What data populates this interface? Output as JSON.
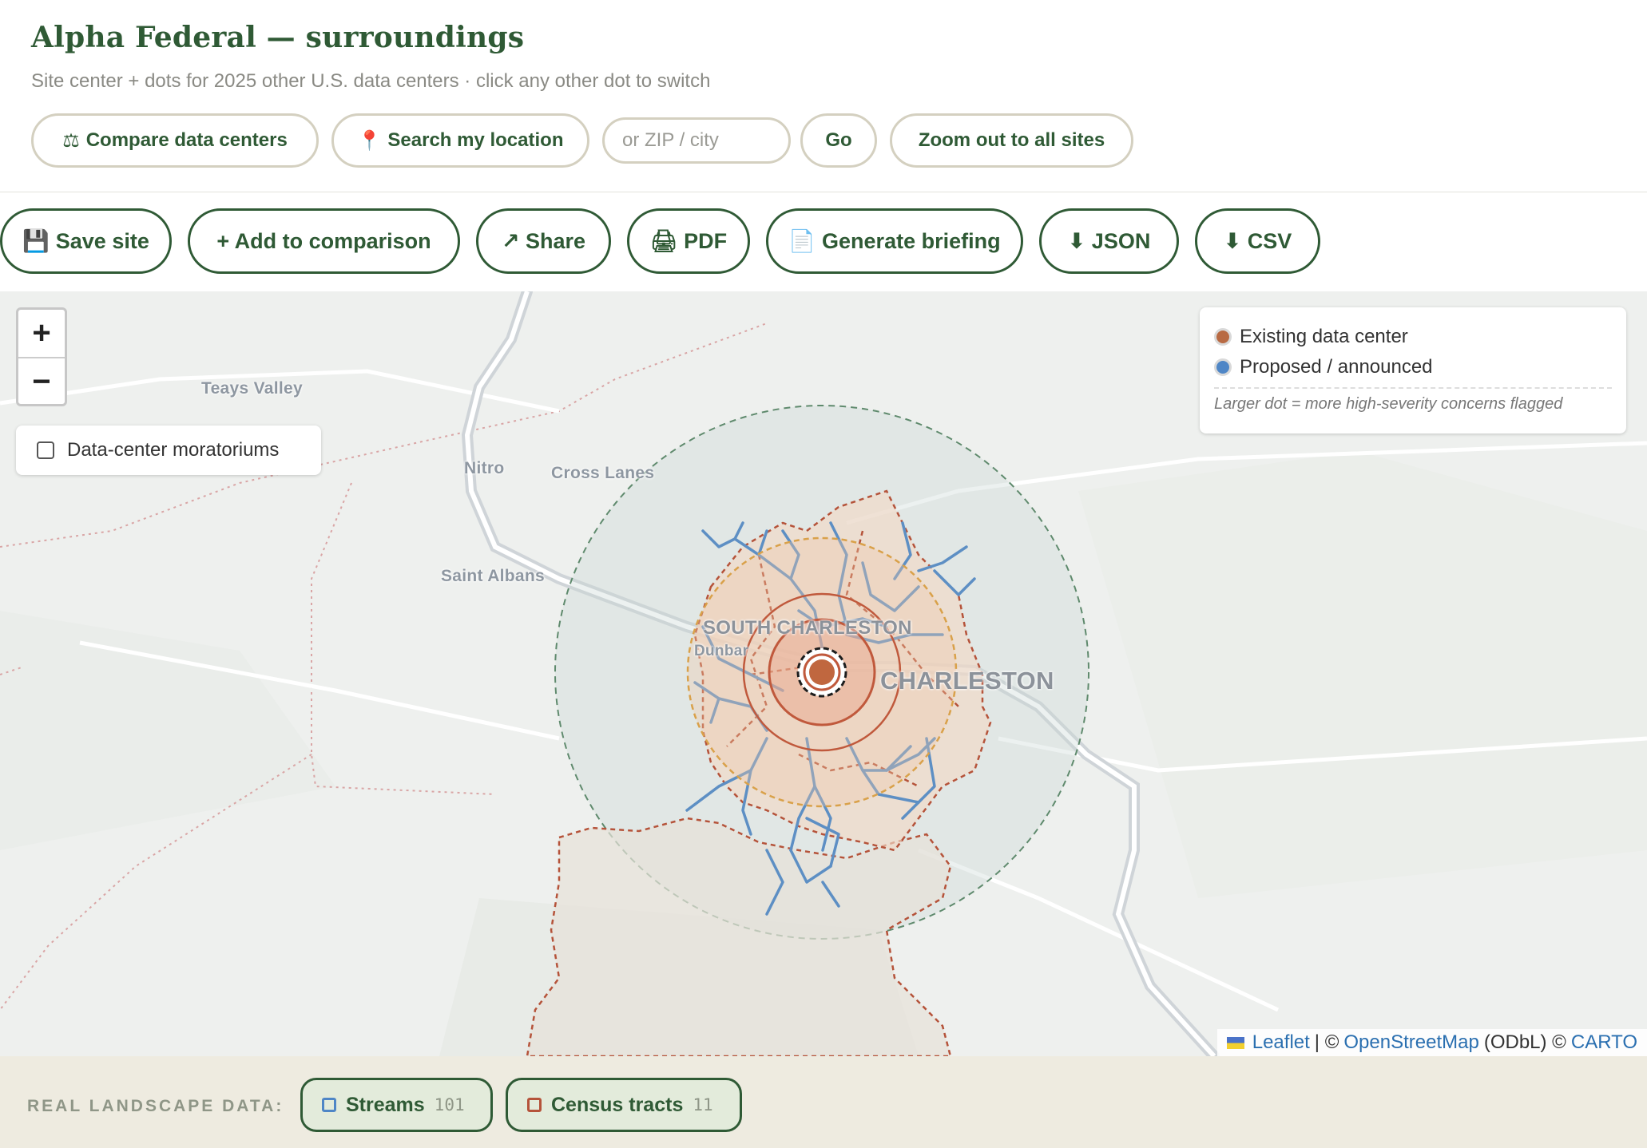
{
  "header": {
    "title": "Alpha Federal — surroundings",
    "subtitle": "Site center + dots for 2025 other U.S. data centers · click any other dot to switch",
    "compare_label": "Compare data centers",
    "search_location_label": "Search my location",
    "zip_placeholder": "or ZIP / city",
    "go_label": "Go",
    "zoom_out_label": "Zoom out to all sites"
  },
  "actions": {
    "save": "Save site",
    "add_comparison": "+ Add to comparison",
    "share": "↗ Share",
    "pdf": "PDF",
    "briefing": "Generate briefing",
    "json": "⬇ JSON",
    "csv": "⬇ CSV"
  },
  "map": {
    "zoom_in": "+",
    "zoom_out": "−",
    "moratorium_label": "Data-center moratoriums",
    "moratorium_checked": false,
    "legend": {
      "existing_label": "Existing data center",
      "existing_color": "#b86a43",
      "proposed_label": "Proposed / announced",
      "proposed_color": "#4f86c6",
      "note": "Larger dot = more high-severity concerns flagged"
    },
    "place_labels": {
      "teays_valley": "Teays Valley",
      "nitro": "Nitro",
      "cross_lanes": "Cross Lanes",
      "saint_albans": "Saint Albans",
      "south_charleston": "SOUTH CHARLESTON",
      "dunbar": "Dunbar",
      "charleston": "CHARLESTON"
    },
    "attribution": {
      "leaflet": "Leaflet",
      "sep1": "| ©",
      "osm": "OpenStreetMap",
      "odbl": "(ODbL) ©",
      "carto": "CARTO"
    }
  },
  "footer": {
    "label": "REAL LANDSCAPE DATA:",
    "streams_label": "Streams",
    "streams_count": "101",
    "streams_color": "#4f86c6",
    "tracts_label": "Census tracts",
    "tracts_count": "11",
    "tracts_color": "#b5533a"
  }
}
